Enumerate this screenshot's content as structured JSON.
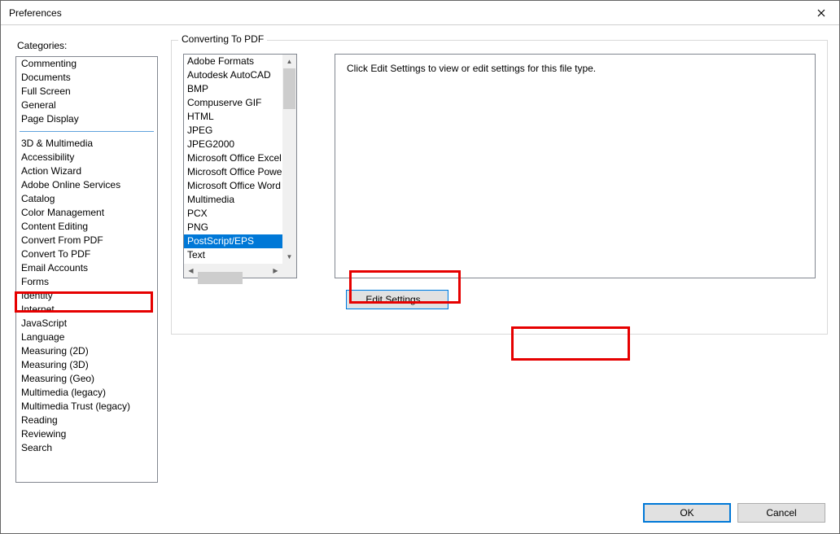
{
  "window": {
    "title": "Preferences"
  },
  "categories": {
    "label": "Categories:",
    "group1": [
      "Commenting",
      "Documents",
      "Full Screen",
      "General",
      "Page Display"
    ],
    "group2": [
      "3D & Multimedia",
      "Accessibility",
      "Action Wizard",
      "Adobe Online Services",
      "Catalog",
      "Color Management",
      "Content Editing",
      "Convert From PDF",
      "Convert To PDF",
      "Email Accounts",
      "Forms",
      "Identity",
      "Internet",
      "JavaScript",
      "Language",
      "Measuring (2D)",
      "Measuring (3D)",
      "Measuring (Geo)",
      "Multimedia (legacy)",
      "Multimedia Trust (legacy)",
      "Reading",
      "Reviewing",
      "Search"
    ],
    "selected": "Convert To PDF"
  },
  "panel": {
    "group_label": "Converting To PDF",
    "formats": [
      "Adobe Formats",
      "Autodesk AutoCAD",
      "BMP",
      "Compuserve GIF",
      "HTML",
      "JPEG",
      "JPEG2000",
      "Microsoft Office Excel",
      "Microsoft Office PowerPoint",
      "Microsoft Office Word",
      "Multimedia",
      "PCX",
      "PNG",
      "PostScript/EPS",
      "Text"
    ],
    "selected_format": "PostScript/EPS",
    "instruction": "Click Edit Settings to view or edit settings for this file type.",
    "edit_button": "Edit Settings..."
  },
  "buttons": {
    "ok": "OK",
    "cancel": "Cancel"
  }
}
